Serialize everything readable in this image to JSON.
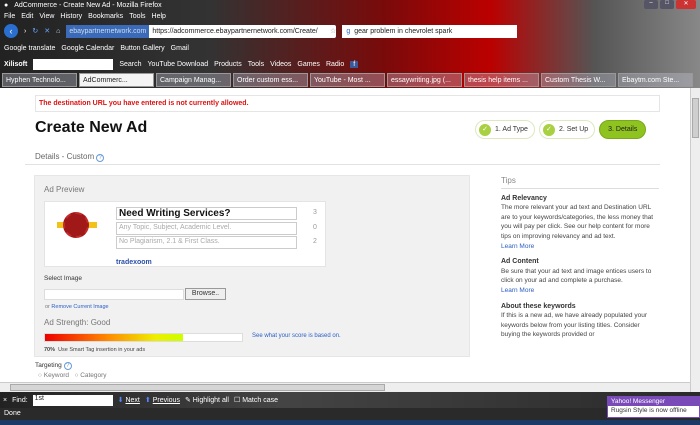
{
  "window": {
    "title": "AdCommerce - Create New Ad - Mozilla Firefox"
  },
  "menu": [
    "File",
    "Edit",
    "View",
    "History",
    "Bookmarks",
    "Tools",
    "Help"
  ],
  "nav": {
    "site_badge": "ebaypartnernetwork.com",
    "url": "https://adcommerce.ebaypartnernetwork.com/Create/",
    "search": "gear problem in chevrolet spark"
  },
  "bookmarks": [
    "Google translate",
    "Google Calendar",
    "Button Gallery",
    "Gmail"
  ],
  "toolbar": {
    "brand": "Xilisoft",
    "items": [
      "Search",
      "YouTube Download",
      "Products",
      "Tools",
      "Videos",
      "Games",
      "Radio"
    ]
  },
  "tabs": [
    "Hyphen Technolo...",
    "AdCommerc...",
    "Campaign Manag...",
    "Order custom ess...",
    "YouTube - Most ...",
    "essaywriting.jpg (...",
    "thesis help items ...",
    "Custom Thesis W...",
    "Ebaytm.com Ste..."
  ],
  "page": {
    "error": "The destination URL you have entered is not currently allowed.",
    "title": "Create New Ad",
    "steps": [
      "1. Ad Type",
      "2. Set Up",
      "3. Details"
    ],
    "subtitle": "Details - Custom",
    "preview": {
      "label": "Ad Preview",
      "headline": "Need Writing Services?",
      "line1": "Any Topic, Subject, Academic Level.",
      "line2": "No Plagiarism, 2.1 & First Class.",
      "counts": [
        "3",
        "0",
        "2"
      ],
      "domain": "tradexoom"
    },
    "select_image": "Select Image",
    "browse": "Browse..",
    "remove_prefix": "or",
    "remove": "Remove Current Image",
    "strength_label": "Ad Strength: Good",
    "strength_percent": 70,
    "strength_text": "70%",
    "strength_hint": "Use Smart Tag insertion in your ads",
    "score_link": "See what your score is based on.",
    "targeting": "Targeting",
    "targeting_options": [
      "Keyword",
      "Category"
    ]
  },
  "tips": {
    "title": "Tips",
    "sections": [
      {
        "heading": "Ad Relevancy",
        "body": "The more relevant your ad text and Destination URL are to your keywords/categories, the less money that you will pay per click. See our help content for more tips on improving relevancy and ad text.",
        "link": "Learn More"
      },
      {
        "heading": "Ad Content",
        "body": "Be sure that your ad text and image entices users to click on your ad and complete a purchase.",
        "link": "Learn More"
      },
      {
        "heading": "About these keywords",
        "body": "If this is a new ad, we have already populated your keywords below from your listing titles. Consider buying the keywords provided or"
      }
    ]
  },
  "findbar": {
    "label": "Find:",
    "value": "1st",
    "next": "Next",
    "previous": "Previous",
    "highlight": "Highlight all",
    "match_case": "Match case"
  },
  "status": "Done",
  "messenger": {
    "title": "Yahoo! Messenger",
    "message": "Rugsin Style is now offline"
  }
}
